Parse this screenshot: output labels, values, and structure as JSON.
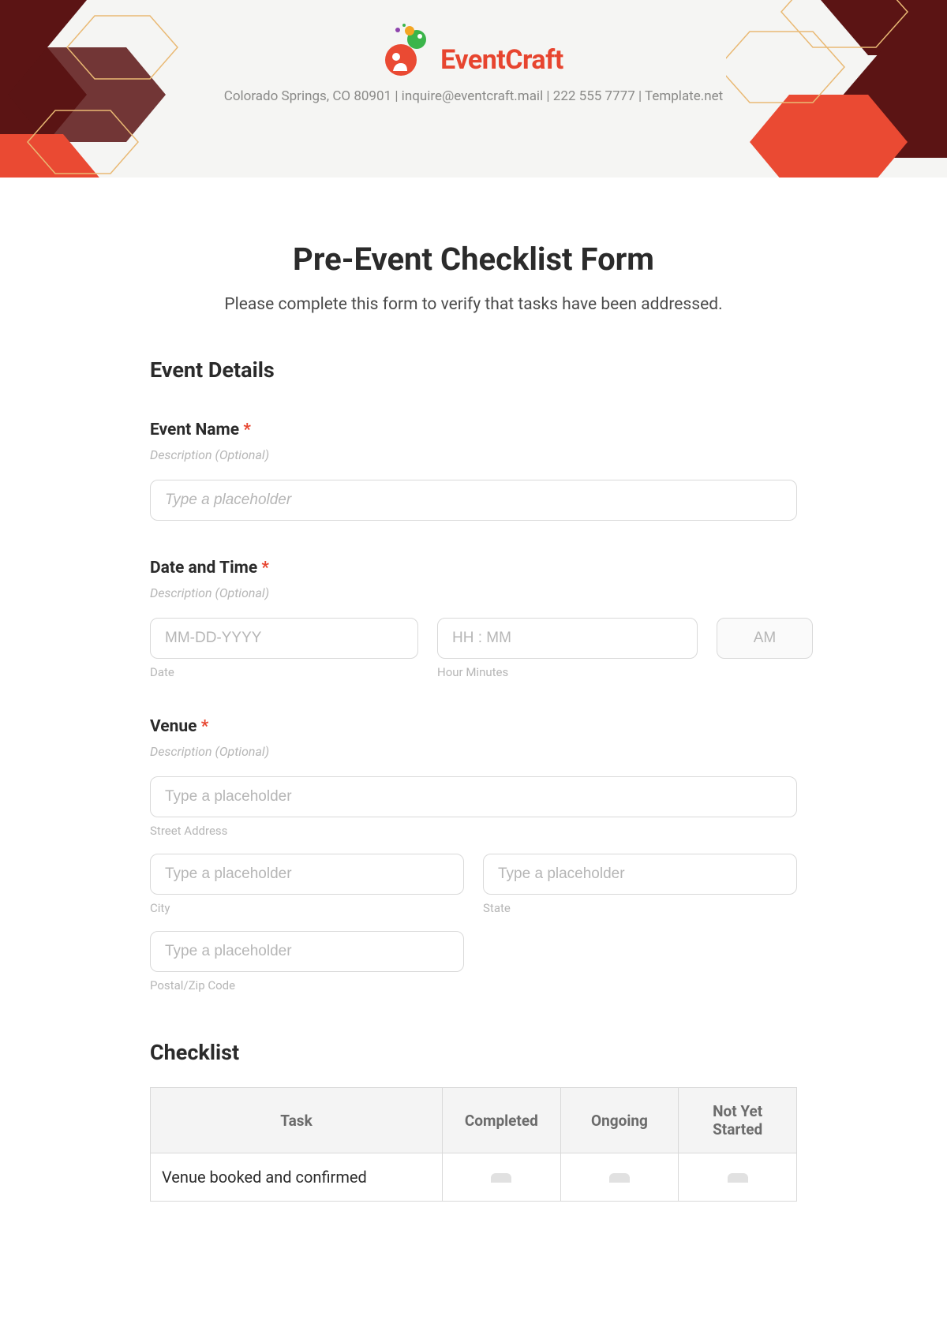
{
  "brand": {
    "name": "EventCraft",
    "tagline": "Colorado Springs, CO 80901 | inquire@eventcraft.mail | 222 555 7777 | Template.net"
  },
  "form": {
    "title": "Pre-Event Checklist Form",
    "subtitle": "Please complete this form to verify that tasks have been addressed."
  },
  "sections": {
    "event_details": "Event Details",
    "checklist": "Checklist"
  },
  "fields": {
    "event_name": {
      "label": "Event Name",
      "desc": "Description (Optional)",
      "placeholder": "Type a placeholder"
    },
    "date_time": {
      "label": "Date and Time",
      "desc": "Description (Optional)",
      "date_placeholder": "MM-DD-YYYY",
      "time_placeholder": "HH : MM",
      "ampm_value": "AM",
      "date_sub": "Date",
      "time_sub": "Hour Minutes"
    },
    "venue": {
      "label": "Venue",
      "desc": "Description (Optional)",
      "street_placeholder": "Type a placeholder",
      "street_sub": "Street Address",
      "city_placeholder": "Type a placeholder",
      "city_sub": "City",
      "state_placeholder": "Type a placeholder",
      "state_sub": "State",
      "postal_placeholder": "Type a placeholder",
      "postal_sub": "Postal/Zip Code"
    }
  },
  "checklist_table": {
    "headers": {
      "task": "Task",
      "completed": "Completed",
      "ongoing": "Ongoing",
      "not_started": "Not Yet Started"
    },
    "rows": [
      {
        "task": "Venue booked and confirmed"
      }
    ]
  }
}
